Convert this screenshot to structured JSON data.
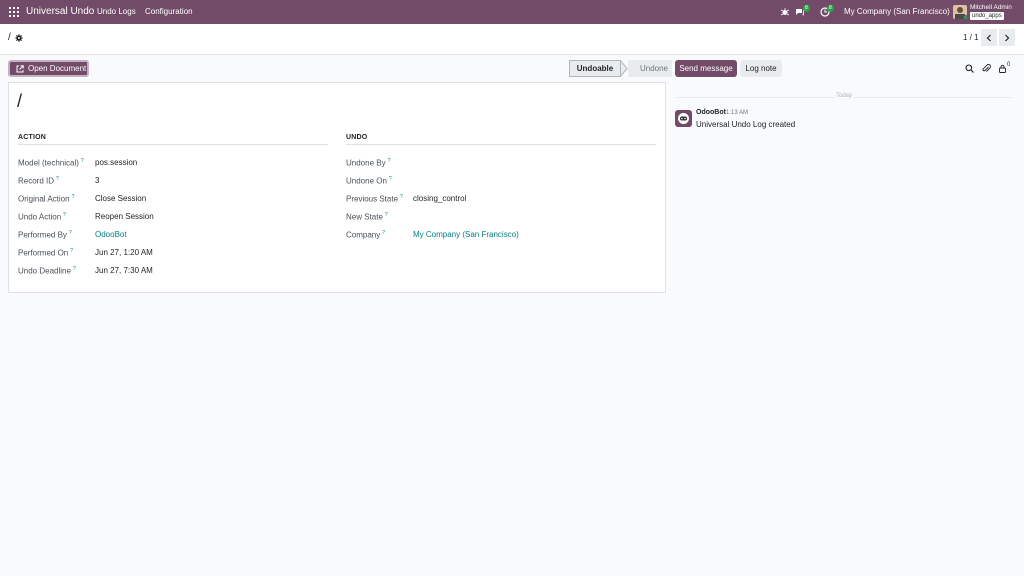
{
  "navbar": {
    "app_name": "Universal Undo",
    "menu": [
      "Undo Logs",
      "Configuration"
    ],
    "messages_count": "8",
    "activities_count": "8",
    "company": "My Company (San Francisco)",
    "user_name": "Mitchell Admin",
    "database": "undo_apps"
  },
  "control_panel": {
    "breadcrumb": "/",
    "pager": "1 / 1"
  },
  "form": {
    "open_document_label": "Open Document",
    "status": {
      "active": "Undoable",
      "inactive": "Undone"
    },
    "title": "/",
    "action_group": {
      "title": "ACTION",
      "fields": [
        {
          "label": "Model (technical)",
          "value": "pos.session"
        },
        {
          "label": "Record ID",
          "value": "3"
        },
        {
          "label": "Original Action",
          "value": "Close Session"
        },
        {
          "label": "Undo Action",
          "value": "Reopen Session"
        },
        {
          "label": "Performed By",
          "value": "OdooBot"
        },
        {
          "label": "Performed On",
          "value": "Jun 27, 1:20 AM"
        },
        {
          "label": "Undo Deadline",
          "value": "Jun 27, 7:30 AM"
        }
      ]
    },
    "undo_group": {
      "title": "UNDO",
      "fields": [
        {
          "label": "Undone By",
          "value": ""
        },
        {
          "label": "Undone On",
          "value": ""
        },
        {
          "label": "Previous State",
          "value": "closing_control"
        },
        {
          "label": "New State",
          "value": ""
        },
        {
          "label": "Company",
          "value": "My Company (San Francisco)"
        }
      ]
    },
    "help_marker": "?"
  },
  "chatter": {
    "send_message_label": "Send message",
    "log_note_label": "Log note",
    "followers_count": "0",
    "day_label": "Today",
    "message": {
      "author": "OdooBot",
      "time": "1:13 AM",
      "body": "Universal Undo Log created"
    }
  },
  "colors": {
    "brand": "#714b67",
    "link": "#017e84",
    "badge": "#28a745"
  }
}
